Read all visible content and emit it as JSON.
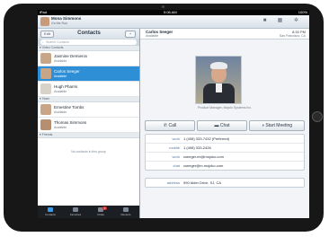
{
  "status": {
    "carrier": "iPad",
    "time": "9:06 AM",
    "battery": "100%"
  },
  "user": {
    "name": "Mona Simmons",
    "status": "On the Run"
  },
  "contacts_panel": {
    "edit_label": "Edit",
    "title": "Contacts",
    "add_label": "+",
    "search_placeholder": "Search Contacts",
    "section_favorites": "Video Contacts",
    "section_team": "Team",
    "section_friends": "Friends",
    "empty_text": "No contacts in this group",
    "contacts": [
      {
        "name": "Jasmine Demierov",
        "status": "Available"
      },
      {
        "name": "Carlos Seeger",
        "status": "Available"
      },
      {
        "name": "Hugh Pharris",
        "status": "Available"
      },
      {
        "name": "Ernestine Tombs",
        "status": "Available"
      },
      {
        "name": "Thomas Simmons",
        "status": "Available"
      }
    ]
  },
  "tabs": [
    {
      "label": "Contacts",
      "icon": "contacts-icon"
    },
    {
      "label": "Favorites",
      "icon": "star-icon"
    },
    {
      "label": "Chats",
      "icon": "chat-icon",
      "badge": "3"
    },
    {
      "label": "Recents",
      "icon": "clock-icon"
    }
  ],
  "detail": {
    "name": "Carlos Seeger",
    "status": "Available",
    "time": "8:30 PM",
    "location": "San Francisco, CA",
    "photo_caption": "Product Manager, Mojolo Systems Inc.",
    "call_label": "Call",
    "chat_label": "Chat",
    "meeting_label": "Start Meeting",
    "fields": [
      {
        "label": "work",
        "value": "1 (408) 333-7432 (Preferred)"
      },
      {
        "label": "mobile",
        "value": "1 (408) 333-2426"
      },
      {
        "label": "work",
        "value": "cseeger.ex@mojoko.com"
      },
      {
        "label": "chat",
        "value": "cseeger@m.mojoko.com"
      }
    ],
    "address_label": "address",
    "address_value": "990 Alder Drive, SJ, CA"
  },
  "colors": {
    "accent": "#2f8fd6",
    "badge": "#d62f2f"
  }
}
